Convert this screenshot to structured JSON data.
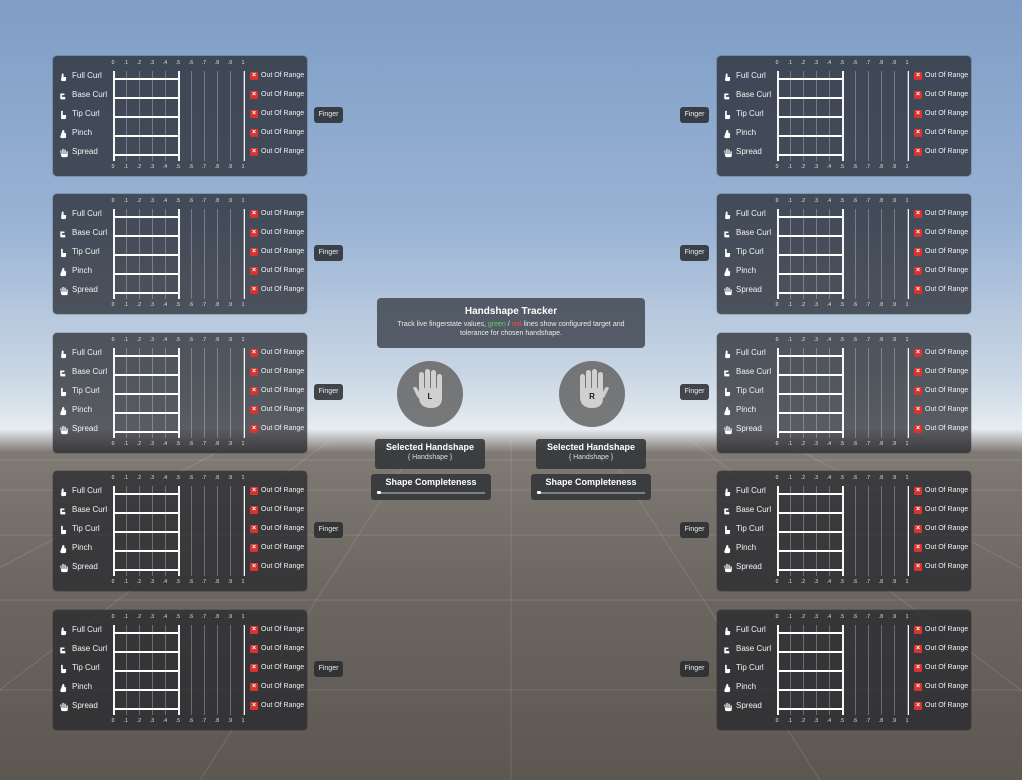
{
  "tracker": {
    "title": "Handshape Tracker",
    "desc_prefix": "Track live fingerstate values,",
    "green_word": "green",
    "slash": "/",
    "red_word": "red",
    "desc_suffix": "lines show configured target and tolerance for chosen handshape."
  },
  "hands": {
    "left": {
      "letter": "L",
      "selected_label": "Selected Handshape",
      "selected_value": "{ Handshape }",
      "completeness_label": "Shape Completeness",
      "completeness": 0
    },
    "right": {
      "letter": "R",
      "selected_label": "Selected Handshape",
      "selected_value": "{ Handshape }",
      "completeness_label": "Shape Completeness",
      "completeness": 0
    }
  },
  "finger_button_label": "Finger",
  "ticks": [
    "0",
    ".1",
    ".2",
    ".3",
    ".4",
    ".5",
    ".6",
    ".7",
    ".8",
    ".9",
    "1"
  ],
  "rows": [
    {
      "label": "Full Curl",
      "value": 0.5,
      "status": "Out Of Range"
    },
    {
      "label": "Base Curl",
      "value": 0.5,
      "status": "Out Of Range"
    },
    {
      "label": "Tip Curl",
      "value": 0.5,
      "status": "Out Of Range"
    },
    {
      "label": "Pinch",
      "value": 0.5,
      "status": "Out Of Range"
    },
    {
      "label": "Spread",
      "value": 0.5,
      "status": "Out Of Range"
    }
  ],
  "colors": {
    "accent_green": "#5bd65b",
    "accent_red": "#ff4a4a",
    "status_icon": "#d8342f"
  },
  "icons": [
    "hand-full-curl-icon",
    "hand-base-curl-icon",
    "hand-tip-curl-icon",
    "hand-pinch-icon",
    "hand-spread-icon",
    "close-x-icon"
  ]
}
